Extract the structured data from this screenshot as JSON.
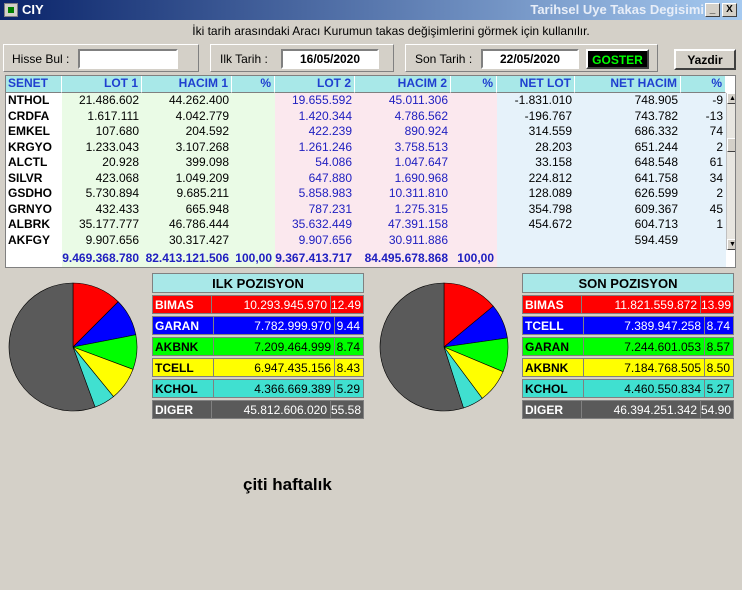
{
  "window": {
    "title": "CIY",
    "title_right": "Tarihsel Uye Takas Degisimi",
    "minimize": "_",
    "close": "X"
  },
  "info_text": "İki tarih arasındaki  Aracı Kurumun takas değişimlerini görmek için kullanılır.",
  "filters": {
    "hisse_label": "Hisse Bul :",
    "hisse_value": "",
    "ilk_label": "Ilk Tarih :",
    "ilk_value": "16/05/2020",
    "son_label": "Son Tarih :",
    "son_value": "22/05/2020",
    "goster_label": "GOSTER",
    "yazdir_label": "Yazdir"
  },
  "grid": {
    "headers": [
      "SENET",
      "LOT 1",
      "HACIM 1",
      "%",
      "LOT 2",
      "HACIM 2",
      "%",
      "NET LOT",
      "NET HACIM",
      "%"
    ],
    "rows": [
      [
        "NTHOL",
        "21.486.602",
        "44.262.400",
        "",
        "19.655.592",
        "45.011.306",
        "",
        "-1.831.010",
        "748.905",
        "-9"
      ],
      [
        "CRDFA",
        "1.617.111",
        "4.042.779",
        "",
        "1.420.344",
        "4.786.562",
        "",
        "-196.767",
        "743.782",
        "-13"
      ],
      [
        "EMKEL",
        "107.680",
        "204.592",
        "",
        "422.239",
        "890.924",
        "",
        "314.559",
        "686.332",
        "74"
      ],
      [
        "KRGYO",
        "1.233.043",
        "3.107.268",
        "",
        "1.261.246",
        "3.758.513",
        "",
        "28.203",
        "651.244",
        "2"
      ],
      [
        "ALCTL",
        "20.928",
        "399.098",
        "",
        "54.086",
        "1.047.647",
        "",
        "33.158",
        "648.548",
        "61"
      ],
      [
        "SILVR",
        "423.068",
        "1.049.209",
        "",
        "647.880",
        "1.690.968",
        "",
        "224.812",
        "641.758",
        "34"
      ],
      [
        "GSDHO",
        "5.730.894",
        "9.685.211",
        "",
        "5.858.983",
        "10.311.810",
        "",
        "128.089",
        "626.599",
        "2"
      ],
      [
        "GRNYO",
        "432.433",
        "665.948",
        "",
        "787.231",
        "1.275.315",
        "",
        "354.798",
        "609.367",
        "45"
      ],
      [
        "ALBRK",
        "35.177.777",
        "46.786.444",
        "",
        "35.632.449",
        "47.391.158",
        "",
        "454.672",
        "604.713",
        "1"
      ],
      [
        "AKFGY",
        "9.907.656",
        "30.317.427",
        "",
        "9.907.656",
        "30.911.886",
        "",
        "",
        "594.459",
        ""
      ]
    ],
    "totals": [
      "9.469.368.780",
      "82.413.121.506",
      "100,00",
      "9.367.413.717",
      "84.495.678.868",
      "100,00"
    ]
  },
  "ilk_pozisyon": {
    "title": "ILK POZISYON",
    "rows": [
      {
        "name": "BIMAS",
        "value": "10.293.945.970",
        "pct": "12.49",
        "color": "#ff0000",
        "text": "#ffffff",
        "share": 12.49
      },
      {
        "name": "GARAN",
        "value": "7.782.999.970",
        "pct": "9.44",
        "color": "#0000ff",
        "text": "#ffffff",
        "share": 9.44
      },
      {
        "name": "AKBNK",
        "value": "7.209.464.999",
        "pct": "8.74",
        "color": "#00ff00",
        "text": "#000000",
        "share": 8.74
      },
      {
        "name": "TCELL",
        "value": "6.947.435.156",
        "pct": "8.43",
        "color": "#ffff00",
        "text": "#000000",
        "share": 8.43
      },
      {
        "name": "KCHOL",
        "value": "4.366.669.389",
        "pct": "5.29",
        "color": "#40e0d0",
        "text": "#000000",
        "share": 5.29
      },
      {
        "name": "DIGER",
        "value": "45.812.606.020",
        "pct": "55.58",
        "color": "#5a5a5a",
        "text": "#ffffff",
        "share": 55.58
      }
    ]
  },
  "son_pozisyon": {
    "title": "SON POZISYON",
    "rows": [
      {
        "name": "BIMAS",
        "value": "11.821.559.872",
        "pct": "13.99",
        "color": "#ff0000",
        "text": "#ffffff",
        "share": 13.99
      },
      {
        "name": "TCELL",
        "value": "7.389.947.258",
        "pct": "8.74",
        "color": "#0000ff",
        "text": "#ffffff",
        "share": 8.74
      },
      {
        "name": "GARAN",
        "value": "7.244.601.053",
        "pct": "8.57",
        "color": "#00ff00",
        "text": "#000000",
        "share": 8.57
      },
      {
        "name": "AKBNK",
        "value": "7.184.768.505",
        "pct": "8.50",
        "color": "#ffff00",
        "text": "#000000",
        "share": 8.5
      },
      {
        "name": "KCHOL",
        "value": "4.460.550.834",
        "pct": "5.27",
        "color": "#40e0d0",
        "text": "#000000",
        "share": 5.27
      },
      {
        "name": "DIGER",
        "value": "46.394.251.342",
        "pct": "54.90",
        "color": "#5a5a5a",
        "text": "#ffffff",
        "share": 54.9
      }
    ]
  },
  "footer_note": "çiti haftalık"
}
